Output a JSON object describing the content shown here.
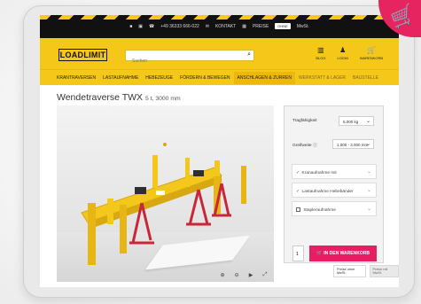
{
  "header": {
    "phone": "+49 36333 666-022",
    "contact": "KONTAKT",
    "price_label": "PREISE",
    "price_toggle": "OHNE",
    "price_tax": "MwSt."
  },
  "search": {
    "placeholder": "Suchen"
  },
  "logo": "LOADLIMIT",
  "user_nav": [
    {
      "label": "BLOG",
      "icon": "blog-icon"
    },
    {
      "label": "LOGIN",
      "icon": "user-icon"
    },
    {
      "label": "WARENKORB",
      "icon": "cart-icon"
    }
  ],
  "categories": [
    "KRANTRAVERSEN",
    "LASTAUFNAHME",
    "HEBEZEUGE",
    "FÖRDERN & BEWEGEN",
    "ANSCHLAGEN & ZURREN",
    "WERKSTATT & LAGER",
    "BAUSTELLE"
  ],
  "product": {
    "name": "Wendetraverse TWX",
    "specs": "5 t, 3000 mm"
  },
  "config": {
    "capacity_label": "Tragfähigkeit",
    "capacity_value": "5.000 kg",
    "grip_label": "Greifweite",
    "grip_value": "1.000 - 3.000 mm",
    "accordion": [
      {
        "label": "Kranaufnahme mit",
        "checked": true
      },
      {
        "label": "Lastaufnahme Hebebänder",
        "checked": true
      },
      {
        "label": "Staplerauf­nahme",
        "checked": false
      }
    ],
    "quantity": "1",
    "cart_button": "IN DEN WARENKORB",
    "price_buttons": [
      "Preise ohne MwSt.",
      "Preise mit MwSt."
    ]
  },
  "colors": {
    "accent_yellow": "#f4c718",
    "cta_pink": "#e61e63",
    "viewer_red": "#c92738"
  }
}
